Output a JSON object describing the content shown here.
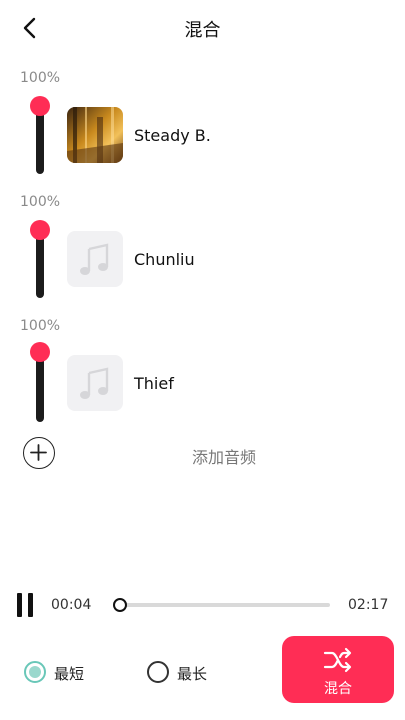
{
  "header": {
    "title": "混合",
    "back_icon": "chevron-left-icon"
  },
  "tracks": [
    {
      "volume_label": "100%",
      "volume": 1.0,
      "name": "Steady B.",
      "cover": "album-art"
    },
    {
      "volume_label": "100%",
      "volume": 1.0,
      "name": "Chunliu",
      "cover": "music-note-icon"
    },
    {
      "volume_label": "100%",
      "volume": 1.0,
      "name": "Thief",
      "cover": "music-note-icon"
    }
  ],
  "add_audio": {
    "label": "添加音频",
    "icon": "plus-circle-icon"
  },
  "player": {
    "current_time": "00:04",
    "total_time": "02:17",
    "progress": 0.03,
    "state_icon": "pause-icon"
  },
  "length_options": {
    "shortest": "最短",
    "longest": "最长",
    "selected": "shortest"
  },
  "mix_button": {
    "label": "混合",
    "icon": "shuffle-icon"
  },
  "colors": {
    "accent": "#ff2d55",
    "radio_selected": "#69c7b8",
    "track": "#1c1c1c"
  }
}
